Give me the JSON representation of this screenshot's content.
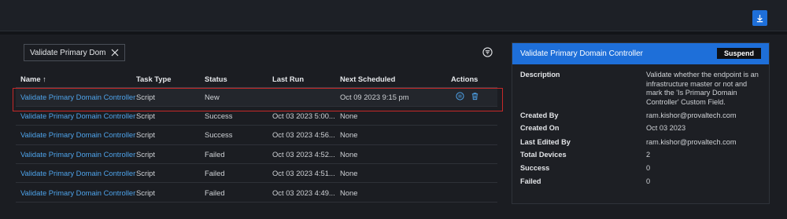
{
  "toolbar": {
    "download_icon": "download-icon"
  },
  "filter": {
    "chip_value": "Validate Primary Dom"
  },
  "table": {
    "headers": {
      "name": "Name ↑",
      "task_type": "Task Type",
      "status": "Status",
      "last_run": "Last Run",
      "next_scheduled": "Next Scheduled",
      "actions": "Actions"
    },
    "rows": [
      {
        "name": "Validate Primary Domain Controller",
        "type": "Script",
        "status": "New",
        "last_run": "",
        "next": "Oct 09 2023 9:15 pm"
      },
      {
        "name": "Validate Primary Domain Controller",
        "type": "Script",
        "status": "Success",
        "last_run": "Oct 03 2023 5:00...",
        "next": "None"
      },
      {
        "name": "Validate Primary Domain Controller",
        "type": "Script",
        "status": "Success",
        "last_run": "Oct 03 2023 4:56...",
        "next": "None"
      },
      {
        "name": "Validate Primary Domain Controller",
        "type": "Script",
        "status": "Failed",
        "last_run": "Oct 03 2023 4:52...",
        "next": "None"
      },
      {
        "name": "Validate Primary Domain Controller",
        "type": "Script",
        "status": "Failed",
        "last_run": "Oct 03 2023 4:51...",
        "next": "None"
      },
      {
        "name": "Validate Primary Domain Controller",
        "type": "Script",
        "status": "Failed",
        "last_run": "Oct 03 2023 4:49...",
        "next": "None"
      }
    ]
  },
  "panel": {
    "title": "Validate Primary Domain Controller",
    "suspend_label": "Suspend",
    "description_label": "Description",
    "description_value": "Validate whether the endpoint is an infrastructure master or not and mark the 'Is Primary Domain Controller' Custom Field.",
    "created_by_label": "Created By",
    "created_by_value": "ram.kishor@provaltech.com",
    "created_on_label": "Created On",
    "created_on_value": "Oct 03 2023",
    "last_edited_by_label": "Last Edited By",
    "last_edited_by_value": "ram.kishor@provaltech.com",
    "total_devices_label": "Total Devices",
    "total_devices_value": "2",
    "success_label": "Success",
    "success_value": "0",
    "failed_label": "Failed",
    "failed_value": "0"
  },
  "colors": {
    "accent": "#1e6fd9",
    "link": "#4ea3ea",
    "highlight": "#c62828"
  }
}
